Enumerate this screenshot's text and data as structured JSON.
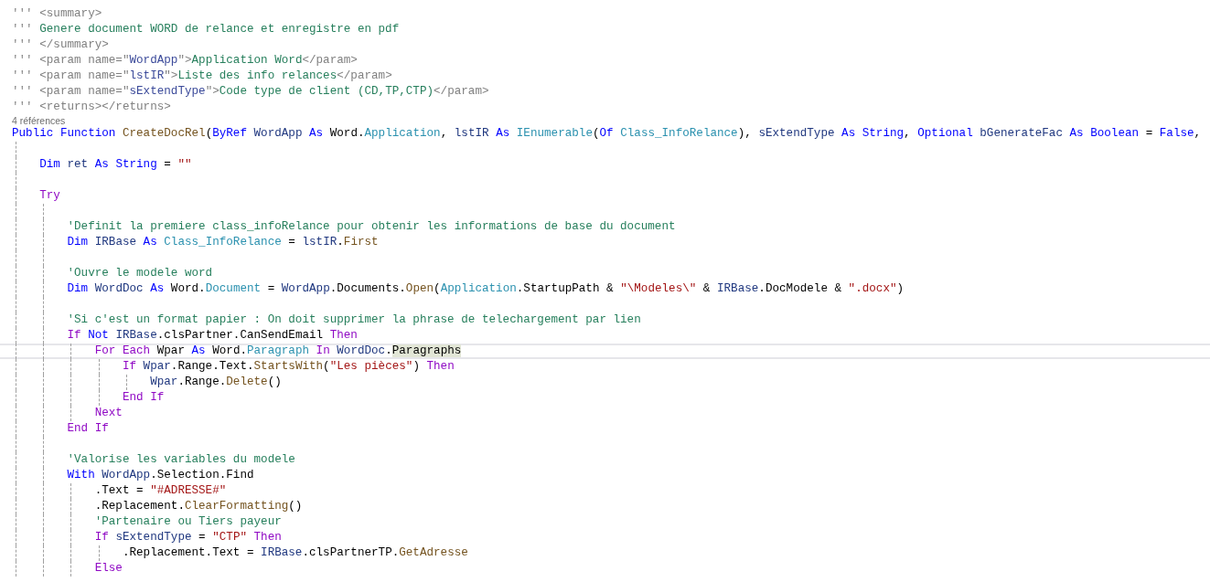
{
  "editor": {
    "lines": [
      {
        "kind": "code",
        "current": false,
        "tokens": [
          {
            "kind": "doc",
            "text": "''' "
          },
          {
            "kind": "doc",
            "text": "<summary>"
          }
        ]
      },
      {
        "kind": "code",
        "current": false,
        "tokens": [
          {
            "kind": "doc",
            "text": "''' "
          },
          {
            "kind": "comment",
            "text": "Genere document WORD de relance et enregistre en pdf"
          }
        ]
      },
      {
        "kind": "code",
        "current": false,
        "tokens": [
          {
            "kind": "doc",
            "text": "''' "
          },
          {
            "kind": "doc",
            "text": "</summary>"
          }
        ]
      },
      {
        "kind": "code",
        "current": false,
        "tokens": [
          {
            "kind": "doc",
            "text": "''' <param name=\""
          },
          {
            "kind": "docname",
            "text": "WordApp"
          },
          {
            "kind": "doc",
            "text": "\">"
          },
          {
            "kind": "comment",
            "text": "Application Word"
          },
          {
            "kind": "doc",
            "text": "</param>"
          }
        ]
      },
      {
        "kind": "code",
        "current": false,
        "tokens": [
          {
            "kind": "doc",
            "text": "''' <param name=\""
          },
          {
            "kind": "docname",
            "text": "lstIR"
          },
          {
            "kind": "doc",
            "text": "\">"
          },
          {
            "kind": "comment",
            "text": "Liste des info relances"
          },
          {
            "kind": "doc",
            "text": "</param>"
          }
        ]
      },
      {
        "kind": "code",
        "current": false,
        "tokens": [
          {
            "kind": "doc",
            "text": "''' <param name=\""
          },
          {
            "kind": "docname",
            "text": "sExtendType"
          },
          {
            "kind": "doc",
            "text": "\">"
          },
          {
            "kind": "comment",
            "text": "Code type de client (CD,TP,CTP)"
          },
          {
            "kind": "doc",
            "text": "</param>"
          }
        ]
      },
      {
        "kind": "code",
        "current": false,
        "tokens": [
          {
            "kind": "doc",
            "text": "''' <returns></returns>"
          }
        ]
      },
      {
        "kind": "codelens",
        "text": "4 références"
      },
      {
        "kind": "code",
        "current": false,
        "tokens": [
          {
            "kind": "keyword",
            "text": "Public Function "
          },
          {
            "kind": "method",
            "text": "CreateDocRel"
          },
          {
            "kind": "plain",
            "text": "("
          },
          {
            "kind": "keyword",
            "text": "ByRef "
          },
          {
            "kind": "local",
            "text": "WordApp "
          },
          {
            "kind": "keyword",
            "text": "As "
          },
          {
            "kind": "plain",
            "text": "Word."
          },
          {
            "kind": "type",
            "text": "Application"
          },
          {
            "kind": "plain",
            "text": ", "
          },
          {
            "kind": "local",
            "text": "lstIR "
          },
          {
            "kind": "keyword",
            "text": "As "
          },
          {
            "kind": "type",
            "text": "IEnumerable"
          },
          {
            "kind": "plain",
            "text": "("
          },
          {
            "kind": "keyword",
            "text": "Of "
          },
          {
            "kind": "type",
            "text": "Class_InfoRelance"
          },
          {
            "kind": "plain",
            "text": "), "
          },
          {
            "kind": "local",
            "text": "sExtendType "
          },
          {
            "kind": "keyword",
            "text": "As String"
          },
          {
            "kind": "plain",
            "text": ", "
          },
          {
            "kind": "keyword",
            "text": "Optional "
          },
          {
            "kind": "local",
            "text": "bGenerateFac "
          },
          {
            "kind": "keyword",
            "text": "As Boolean "
          },
          {
            "kind": "plain",
            "text": "= "
          },
          {
            "kind": "keyword",
            "text": "False"
          },
          {
            "kind": "plain",
            "text": ","
          }
        ]
      },
      {
        "kind": "blank"
      },
      {
        "kind": "code",
        "current": false,
        "tokens": [
          {
            "kind": "keyword",
            "text": "    Dim "
          },
          {
            "kind": "local",
            "text": "ret "
          },
          {
            "kind": "keyword",
            "text": "As String "
          },
          {
            "kind": "plain",
            "text": "= "
          },
          {
            "kind": "string",
            "text": "\"\""
          }
        ]
      },
      {
        "kind": "blank"
      },
      {
        "kind": "code",
        "current": false,
        "tokens": [
          {
            "kind": "control",
            "text": "    Try"
          }
        ]
      },
      {
        "kind": "blank"
      },
      {
        "kind": "code",
        "current": false,
        "tokens": [
          {
            "kind": "comment",
            "text": "        'Definit la premiere class_infoRelance pour obtenir les informations de base du document"
          }
        ]
      },
      {
        "kind": "code",
        "current": false,
        "tokens": [
          {
            "kind": "keyword",
            "text": "        Dim "
          },
          {
            "kind": "local",
            "text": "IRBase "
          },
          {
            "kind": "keyword",
            "text": "As "
          },
          {
            "kind": "type",
            "text": "Class_InfoRelance"
          },
          {
            "kind": "plain",
            "text": " = "
          },
          {
            "kind": "local",
            "text": "lstIR"
          },
          {
            "kind": "plain",
            "text": "."
          },
          {
            "kind": "method",
            "text": "First"
          }
        ]
      },
      {
        "kind": "blank"
      },
      {
        "kind": "code",
        "current": false,
        "tokens": [
          {
            "kind": "comment",
            "text": "        'Ouvre le modele word"
          }
        ]
      },
      {
        "kind": "code",
        "current": false,
        "tokens": [
          {
            "kind": "keyword",
            "text": "        Dim "
          },
          {
            "kind": "local",
            "text": "WordDoc "
          },
          {
            "kind": "keyword",
            "text": "As "
          },
          {
            "kind": "plain",
            "text": "Word."
          },
          {
            "kind": "type",
            "text": "Document"
          },
          {
            "kind": "plain",
            "text": " = "
          },
          {
            "kind": "local",
            "text": "WordApp"
          },
          {
            "kind": "plain",
            "text": ".Documents."
          },
          {
            "kind": "method",
            "text": "Open"
          },
          {
            "kind": "plain",
            "text": "("
          },
          {
            "kind": "type",
            "text": "Application"
          },
          {
            "kind": "plain",
            "text": ".StartupPath & "
          },
          {
            "kind": "string",
            "text": "\"\\Modeles\\\""
          },
          {
            "kind": "plain",
            "text": " & "
          },
          {
            "kind": "local",
            "text": "IRBase"
          },
          {
            "kind": "plain",
            "text": ".DocModele & "
          },
          {
            "kind": "string",
            "text": "\".docx\""
          },
          {
            "kind": "plain",
            "text": ")"
          }
        ]
      },
      {
        "kind": "blank"
      },
      {
        "kind": "code",
        "current": false,
        "tokens": [
          {
            "kind": "comment",
            "text": "        'Si c'est un format papier : On doit supprimer la phrase de telechargement par lien"
          }
        ]
      },
      {
        "kind": "code",
        "current": false,
        "tokens": [
          {
            "kind": "control",
            "text": "        If "
          },
          {
            "kind": "keyword",
            "text": "Not "
          },
          {
            "kind": "local",
            "text": "IRBase"
          },
          {
            "kind": "plain",
            "text": ".clsPartner.CanSendEmail "
          },
          {
            "kind": "control",
            "text": "Then"
          }
        ]
      },
      {
        "kind": "code",
        "current": true,
        "tokens": [
          {
            "kind": "control",
            "text": "            For Each "
          },
          {
            "kind": "plain",
            "text": "Wpar "
          },
          {
            "kind": "keyword",
            "text": "As "
          },
          {
            "kind": "plain",
            "text": "Word."
          },
          {
            "kind": "type",
            "text": "Paragraph"
          },
          {
            "kind": "control",
            "text": " In "
          },
          {
            "kind": "local",
            "text": "WordDoc"
          },
          {
            "kind": "plain",
            "text": "."
          },
          {
            "kind": "match",
            "text": "Paragraphs"
          }
        ]
      },
      {
        "kind": "code",
        "current": false,
        "tokens": [
          {
            "kind": "control",
            "text": "                If "
          },
          {
            "kind": "local",
            "text": "Wpar"
          },
          {
            "kind": "plain",
            "text": ".Range.Text."
          },
          {
            "kind": "method",
            "text": "StartsWith"
          },
          {
            "kind": "plain",
            "text": "("
          },
          {
            "kind": "string",
            "text": "\"Les pièces\""
          },
          {
            "kind": "plain",
            "text": ") "
          },
          {
            "kind": "control",
            "text": "Then"
          }
        ]
      },
      {
        "kind": "code",
        "current": false,
        "tokens": [
          {
            "kind": "local",
            "text": "                    Wpar"
          },
          {
            "kind": "plain",
            "text": ".Range."
          },
          {
            "kind": "method",
            "text": "Delete"
          },
          {
            "kind": "plain",
            "text": "()"
          }
        ]
      },
      {
        "kind": "code",
        "current": false,
        "tokens": [
          {
            "kind": "control",
            "text": "                End If"
          }
        ]
      },
      {
        "kind": "code",
        "current": false,
        "tokens": [
          {
            "kind": "control",
            "text": "            Next"
          }
        ]
      },
      {
        "kind": "code",
        "current": false,
        "tokens": [
          {
            "kind": "control",
            "text": "        End If"
          }
        ]
      },
      {
        "kind": "blank"
      },
      {
        "kind": "code",
        "current": false,
        "tokens": [
          {
            "kind": "comment",
            "text": "        'Valorise les variables du modele"
          }
        ]
      },
      {
        "kind": "code",
        "current": false,
        "tokens": [
          {
            "kind": "keyword",
            "text": "        With "
          },
          {
            "kind": "local",
            "text": "WordApp"
          },
          {
            "kind": "plain",
            "text": ".Selection.Find"
          }
        ]
      },
      {
        "kind": "code",
        "current": false,
        "tokens": [
          {
            "kind": "plain",
            "text": "            .Text = "
          },
          {
            "kind": "string",
            "text": "\"#ADRESSE#\""
          }
        ]
      },
      {
        "kind": "code",
        "current": false,
        "tokens": [
          {
            "kind": "plain",
            "text": "            .Replacement."
          },
          {
            "kind": "method",
            "text": "ClearFormatting"
          },
          {
            "kind": "plain",
            "text": "()"
          }
        ]
      },
      {
        "kind": "code",
        "current": false,
        "tokens": [
          {
            "kind": "comment",
            "text": "            'Partenaire ou Tiers payeur"
          }
        ]
      },
      {
        "kind": "code",
        "current": false,
        "tokens": [
          {
            "kind": "control",
            "text": "            If "
          },
          {
            "kind": "local",
            "text": "sExtendType"
          },
          {
            "kind": "plain",
            "text": " = "
          },
          {
            "kind": "string",
            "text": "\"CTP\""
          },
          {
            "kind": "control",
            "text": " Then"
          }
        ]
      },
      {
        "kind": "code",
        "current": false,
        "tokens": [
          {
            "kind": "plain",
            "text": "                .Replacement.Text = "
          },
          {
            "kind": "local",
            "text": "IRBase"
          },
          {
            "kind": "plain",
            "text": ".clsPartnerTP."
          },
          {
            "kind": "method",
            "text": "GetAdresse"
          }
        ]
      },
      {
        "kind": "code",
        "current": false,
        "tokens": [
          {
            "kind": "control",
            "text": "            Else"
          }
        ]
      },
      {
        "kind": "blank"
      }
    ]
  }
}
